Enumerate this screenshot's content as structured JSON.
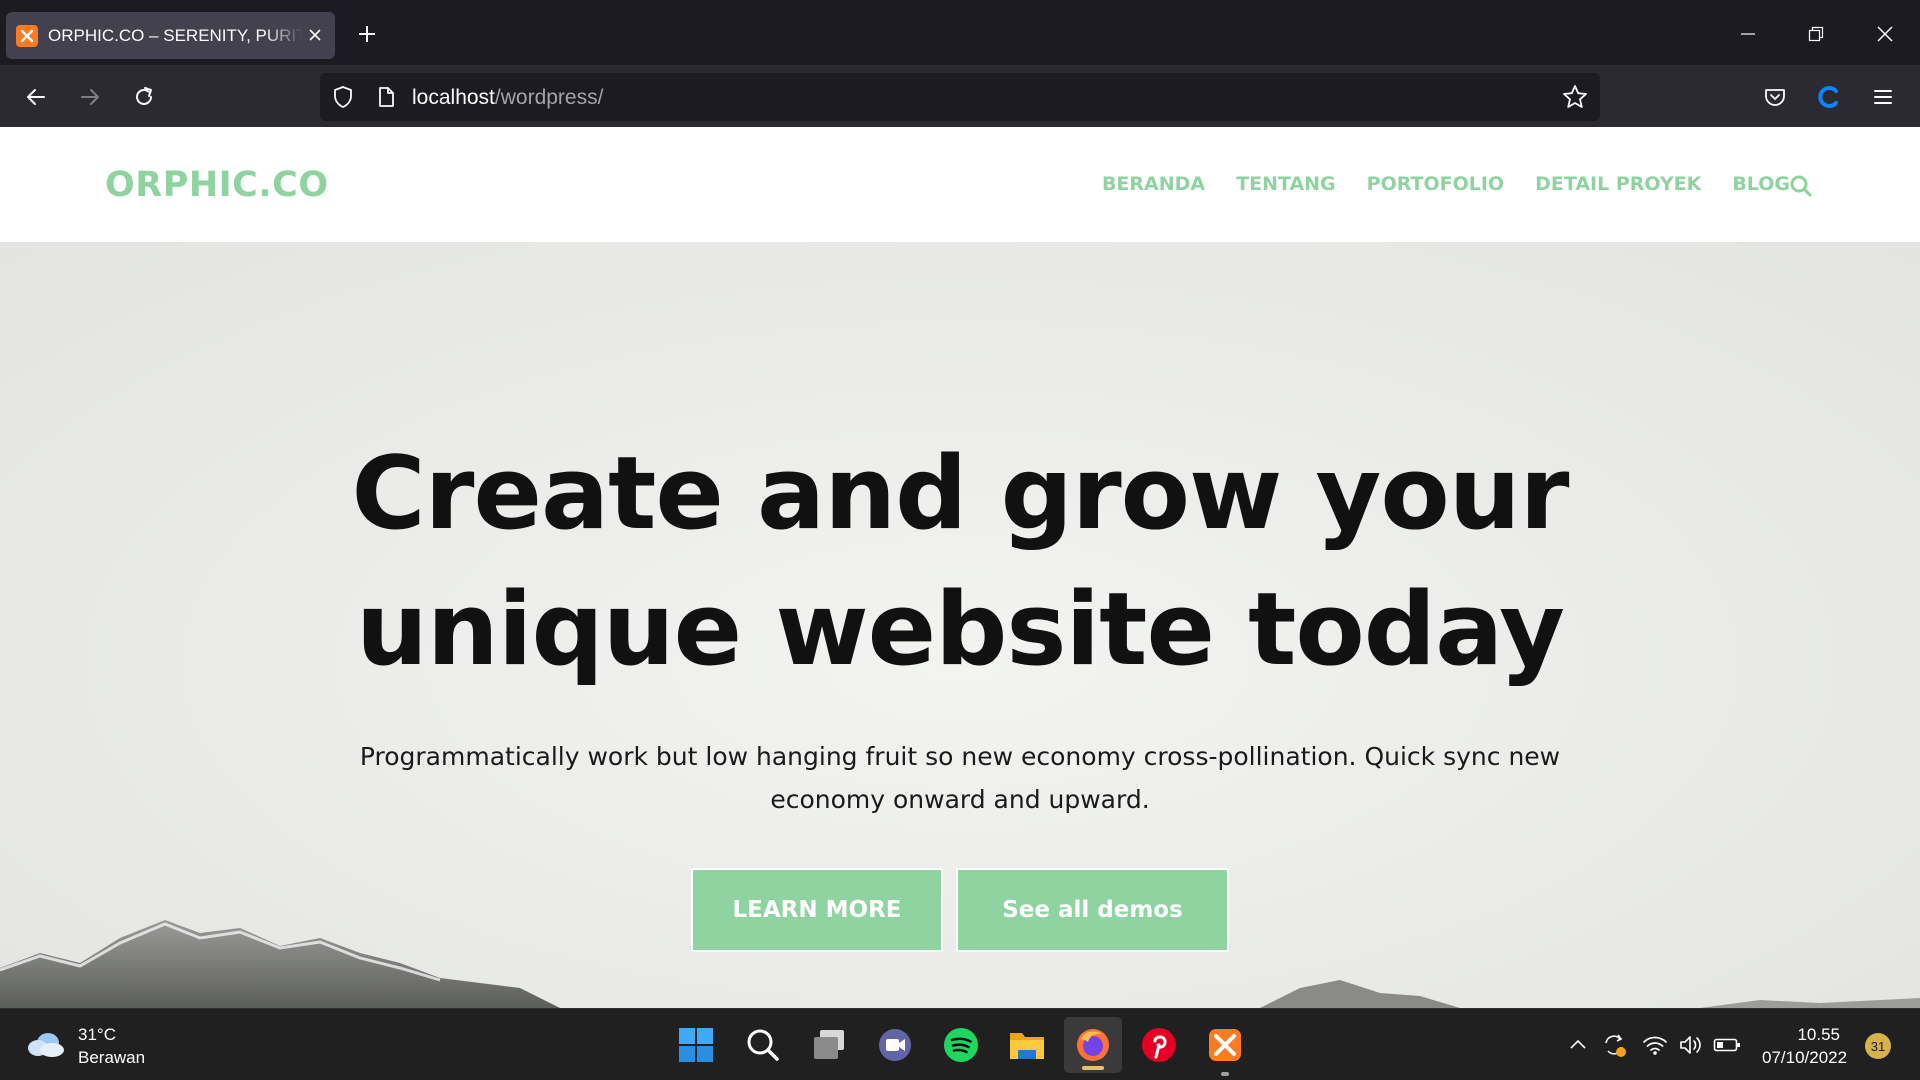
{
  "browser": {
    "tab": {
      "title": "ORPHIC.CO – SERENITY, PURITY"
    },
    "url": {
      "host": "localhost",
      "path": "/wordpress/"
    }
  },
  "site": {
    "logo": "ORPHIC.CO",
    "menu": [
      {
        "label": "BERANDA"
      },
      {
        "label": "TENTANG"
      },
      {
        "label": "PORTOFOLIO"
      },
      {
        "label": "DETAIL PROYEK"
      },
      {
        "label": "BLOG"
      }
    ],
    "hero": {
      "title_line1": "Create and grow your",
      "title_line2": "unique website today",
      "subtitle_line1": "Programmatically work but low hanging fruit so new economy cross-pollination. Quick sync new",
      "subtitle_line2": "economy onward and upward.",
      "buttons": {
        "learn_more": "LEARN MORE",
        "see_demos": "See all demos"
      }
    },
    "accent_color": "#8fd3a0"
  },
  "taskbar": {
    "weather": {
      "temp": "31°C",
      "condition": "Berawan"
    },
    "apps": [
      "windows-start-icon",
      "search-icon",
      "task-view-icon",
      "teams-chat-icon",
      "spotify-icon",
      "file-explorer-icon",
      "firefox-icon",
      "pinterest-icon",
      "xampp-icon"
    ],
    "clock": {
      "time": "10.55",
      "date": "07/10/2022"
    },
    "notification_count": "31"
  }
}
